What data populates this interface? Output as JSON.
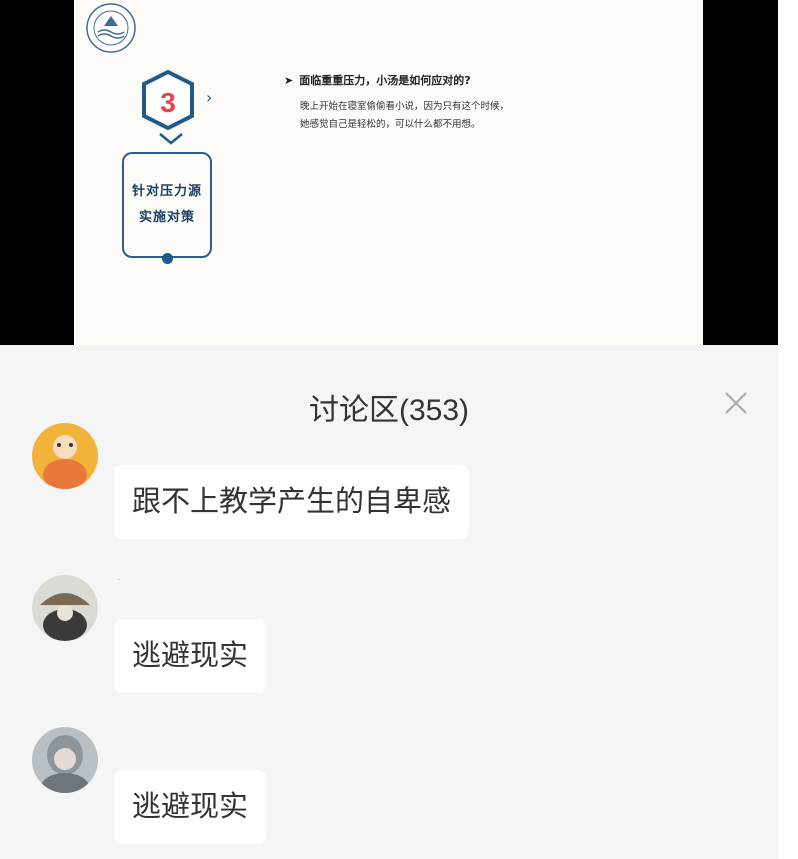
{
  "slide": {
    "step_number": "3",
    "strategy_line1": "针对压力源",
    "strategy_line2": "实施对策",
    "question": "面临重重压力，小汤是如何应对的?",
    "answer_line1": "晚上开始在寝室偷偷看小说，因为只有这个时候，",
    "answer_line2": "她感觉自己是轻松的，可以什么都不用想。"
  },
  "discussion": {
    "title": "讨论区(353)",
    "comments": [
      {
        "text": "跟不上教学产生的自卑感"
      },
      {
        "name": "·",
        "text": "逃避现实"
      },
      {
        "text": "逃避现实"
      }
    ]
  },
  "colors": {
    "slide_bg": "#fcfbf7",
    "accent_blue": "#1f5a8c",
    "badge_red": "#e0484e",
    "panel_bg": "#f5f5f5"
  }
}
